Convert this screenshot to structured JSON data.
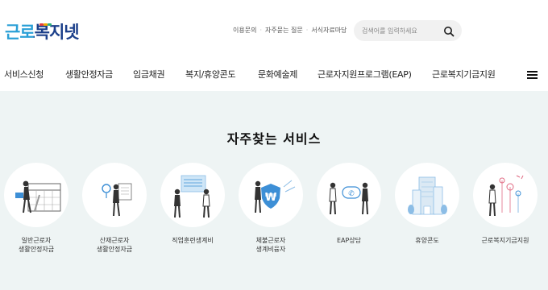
{
  "header": {
    "logo": "근로복지넷",
    "util_links": [
      "이용문의",
      "자주묻는 질문",
      "서식자료마당"
    ],
    "search": {
      "placeholder": "검색어를 입력하세요",
      "icon": "search-icon"
    }
  },
  "nav": {
    "items": [
      "서비스신청",
      "생활안정자금",
      "임금채권",
      "복지/휴양콘도",
      "문화예술제",
      "근로자지원프로그램(EAP)",
      "근로복지기금지원"
    ],
    "menu_icon": "hamburger-menu-icon"
  },
  "main": {
    "title": "자주찾는 서비스",
    "services": [
      {
        "label": "일반근로자\n생활안정자금",
        "icon": "worker-calendar-icon"
      },
      {
        "label": "산재근로자\n생활안정자금",
        "icon": "worker-idea-icon"
      },
      {
        "label": "직업훈련생계비",
        "icon": "training-board-icon"
      },
      {
        "label": "체불근로자\n생계비융자",
        "icon": "won-shield-icon"
      },
      {
        "label": "EAP상담",
        "icon": "phone-counsel-icon"
      },
      {
        "label": "휴양콘도",
        "icon": "condo-building-icon"
      },
      {
        "label": "근로복지기금지원",
        "icon": "fund-support-icon"
      }
    ]
  },
  "colors": {
    "logo_blue": "#2a9fd6",
    "logo_navy": "#1b3f8a",
    "main_bg": "#eef4f4",
    "accent_blue": "#4aa3df"
  }
}
